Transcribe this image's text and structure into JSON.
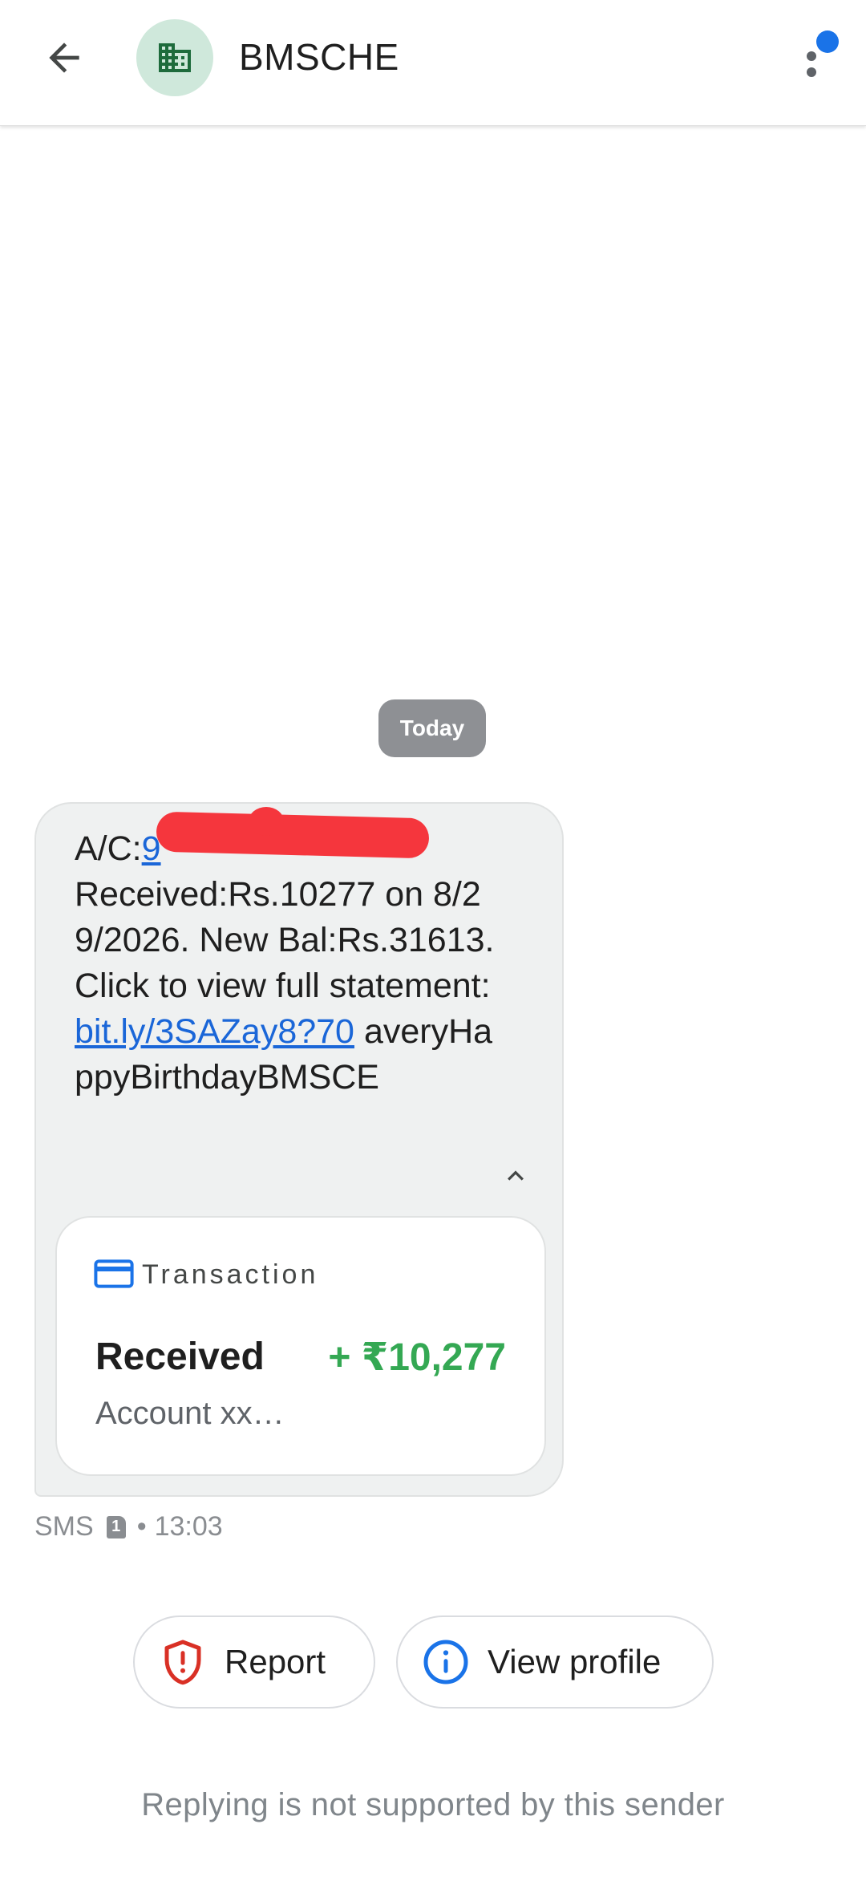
{
  "header": {
    "title": "BMSCHE",
    "back_icon": "arrow-back-icon",
    "avatar_icon": "business-building-icon",
    "menu_icon": "more-vert-icon",
    "notification_color": "#1a73e8"
  },
  "date_divider": "Today",
  "message": {
    "account_prefix": "A/C:",
    "account_link": "9",
    "body": "Received:Rs.10277 on 8/29/2026. New Bal:Rs.31613. Click to view full statement: ",
    "link": "bit.ly/3SAZay8?70",
    "tail": "averyHappyBirthdayBMSCE",
    "collapse_icon": "chevron-up-icon"
  },
  "transaction_card": {
    "icon": "credit-card-icon",
    "label": "Transaction",
    "type": "Received",
    "amount": "+ ₹10,277",
    "account": "Account xx…",
    "amount_color": "#34a853"
  },
  "meta": {
    "channel": "SMS",
    "sim": "1",
    "separator": "•",
    "time": "13:03"
  },
  "actions": {
    "report_label": "Report",
    "report_icon": "shield-alert-icon",
    "view_profile_label": "View profile",
    "view_profile_icon": "info-icon"
  },
  "footer_note": "Replying is not supported by this sender"
}
